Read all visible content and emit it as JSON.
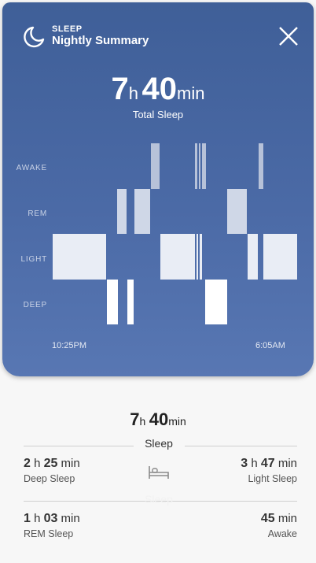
{
  "header": {
    "kicker": "SLEEP",
    "title": "Nightly Summary"
  },
  "total_sleep": {
    "hours": "7",
    "h_unit": "h",
    "minutes": "40",
    "min_unit": "min",
    "label": "Total Sleep"
  },
  "chart": {
    "stages": [
      "AWAKE",
      "REM",
      "LIGHT",
      "DEEP"
    ],
    "start_time": "10:25PM",
    "end_time": "6:05AM"
  },
  "summary": {
    "hours": "7",
    "h_unit": "h",
    "minutes": "40",
    "min_unit": "min",
    "sleep_label": "Sleep",
    "deep": {
      "h": "2",
      "m": "25",
      "label": "Deep Sleep"
    },
    "light": {
      "h": "3",
      "m": "47",
      "label": "Light Sleep"
    },
    "rem": {
      "h": "1",
      "m": "03",
      "label": "REM Sleep"
    },
    "awake": {
      "m": "45",
      "label": "Awake"
    },
    "faded_label": "Sleep"
  },
  "colors": {
    "panel": "#4b6aa6",
    "bar": "#ffffff"
  }
}
